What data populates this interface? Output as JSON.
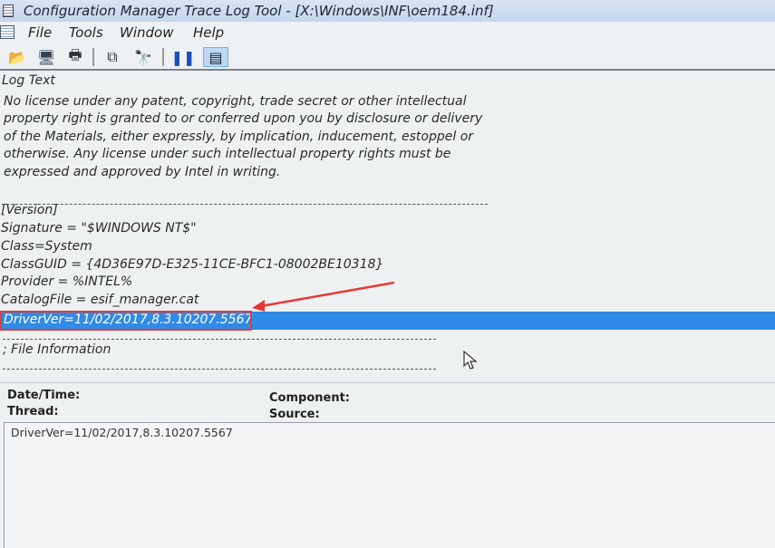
{
  "window": {
    "title": "Configuration Manager Trace Log Tool - [X:\\Windows\\INF\\oem184.inf]"
  },
  "menu": [
    "File",
    "Tools",
    "Window",
    "Help"
  ],
  "toolbar": [
    "open-icon",
    "computer-icon",
    "print-icon",
    "copy-icon",
    "find-icon",
    "pause-icon",
    "log-view-icon"
  ],
  "log": {
    "header": "Log Text",
    "lines": [
      "No license under any patent, copyright, trade secret or other intellectual",
      "property right is granted to or conferred upon you by disclosure or delivery",
      "of the Materials, either expressly, by implication, inducement, estoppel or",
      "otherwise. Any license under such intellectual property rights must be",
      "expressed and approved by Intel in writing.",
      "[Version]",
      "Signature = \"$WINDOWS NT$\"",
      "Class=System",
      "ClassGUID = {4D36E97D-E325-11CE-BFC1-08002BE10318}",
      "Provider = %INTEL%",
      "CatalogFile = esif_manager.cat",
      "DriverVer=11/02/2017,8.3.10207.5567",
      "; File Information"
    ]
  },
  "detail": {
    "date_label": "Date/Time:",
    "thread_label": "Thread:",
    "component_label": "Component:",
    "source_label": "Source:",
    "message": "DriverVer=11/02/2017,8.3.10207.5567"
  },
  "colors": {
    "selection": "#2f8be6",
    "annotation": "#e53935"
  }
}
